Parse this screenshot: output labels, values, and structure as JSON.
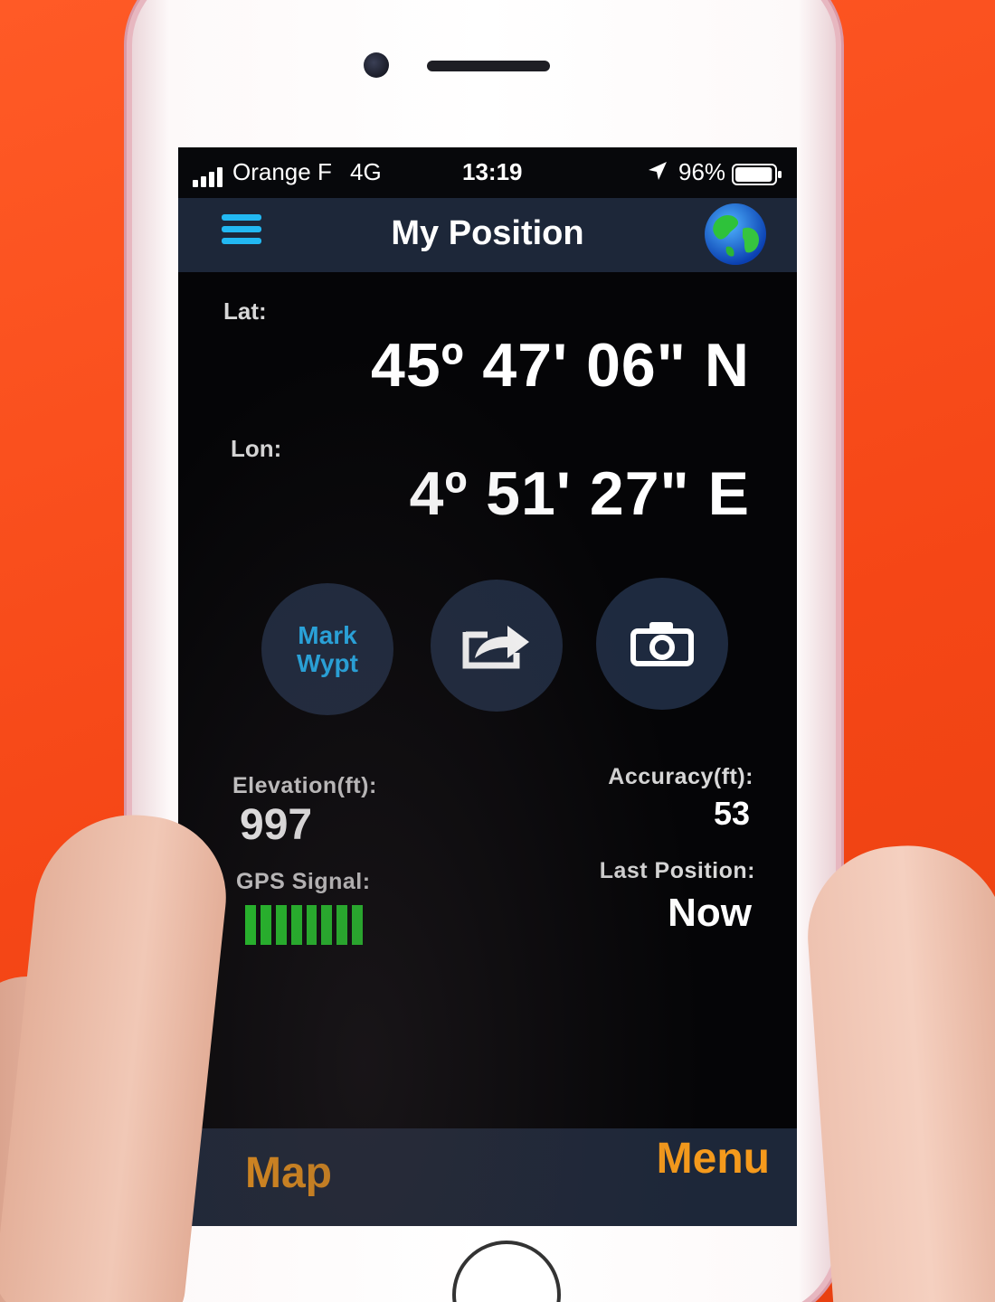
{
  "status_bar": {
    "carrier": "Orange F",
    "network": "4G",
    "time": "13:19",
    "battery_percent": "96%",
    "battery_level": 0.96,
    "icons": [
      "signal-icon",
      "location-arrow-icon",
      "battery-icon"
    ]
  },
  "nav": {
    "title": "My Position",
    "menu_icon": "hamburger-icon",
    "globe_icon": "globe-icon"
  },
  "position": {
    "lat_label": "Lat:",
    "lat_value": "45º 47' 06\" N",
    "lon_label": "Lon:",
    "lon_value": "4º 51' 27\" E"
  },
  "actions": {
    "mark_line1": "Mark",
    "mark_line2": "Wypt",
    "share_icon": "share-icon",
    "camera_icon": "camera-icon"
  },
  "stats": {
    "elevation_label": "Elevation(ft):",
    "elevation_value": "997",
    "accuracy_label": "Accuracy(ft):",
    "accuracy_value": "53",
    "gps_label": "GPS Signal:",
    "gps_bars_lit": 8,
    "gps_bars_total": 8,
    "last_position_label": "Last Position:",
    "last_position_value": "Now"
  },
  "tabs": {
    "map": "Map",
    "menu": "Menu"
  },
  "colors": {
    "accent_blue": "#22b8f2",
    "tab_orange": "#f59a1c",
    "gps_green": "#22d12a",
    "bar_navy": "#1d2739",
    "button_navy": "#1e2a3f"
  }
}
